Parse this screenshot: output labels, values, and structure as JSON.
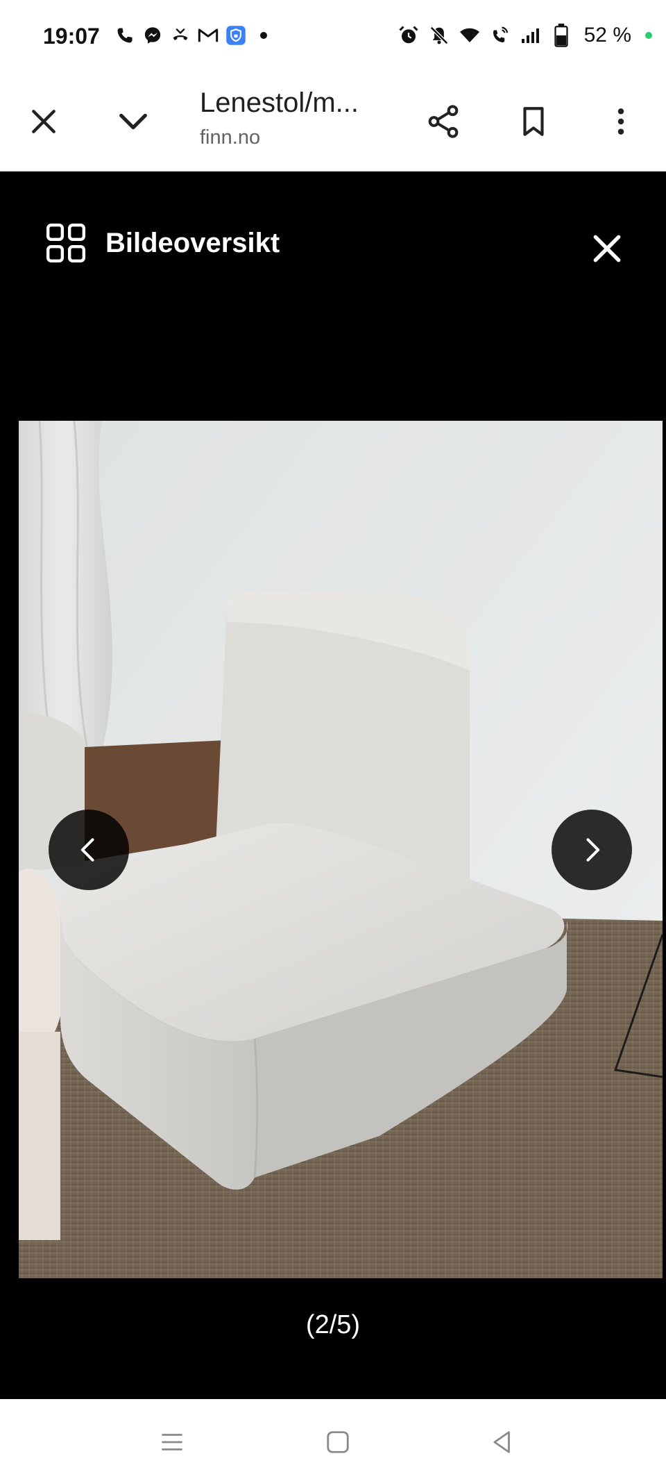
{
  "status_bar": {
    "time": "19:07",
    "battery_percent": "52 %",
    "left_icons": [
      "phone-icon",
      "messenger-icon",
      "missed-call-icon",
      "gmail-icon",
      "vpn-shield-icon",
      "dot-icon"
    ],
    "right_icons": [
      "alarm-icon",
      "bell-off-icon",
      "wifi-icon",
      "wifi-call-icon",
      "signal-icon",
      "battery-icon"
    ]
  },
  "browser": {
    "title": "Lenestol/m...",
    "url": "finn.no"
  },
  "viewer": {
    "header_title": "Bildeoversikt",
    "counter": "(2/5)"
  },
  "colors": {
    "viewer_bg": "#000000",
    "status_dot": "#2ecc71"
  }
}
